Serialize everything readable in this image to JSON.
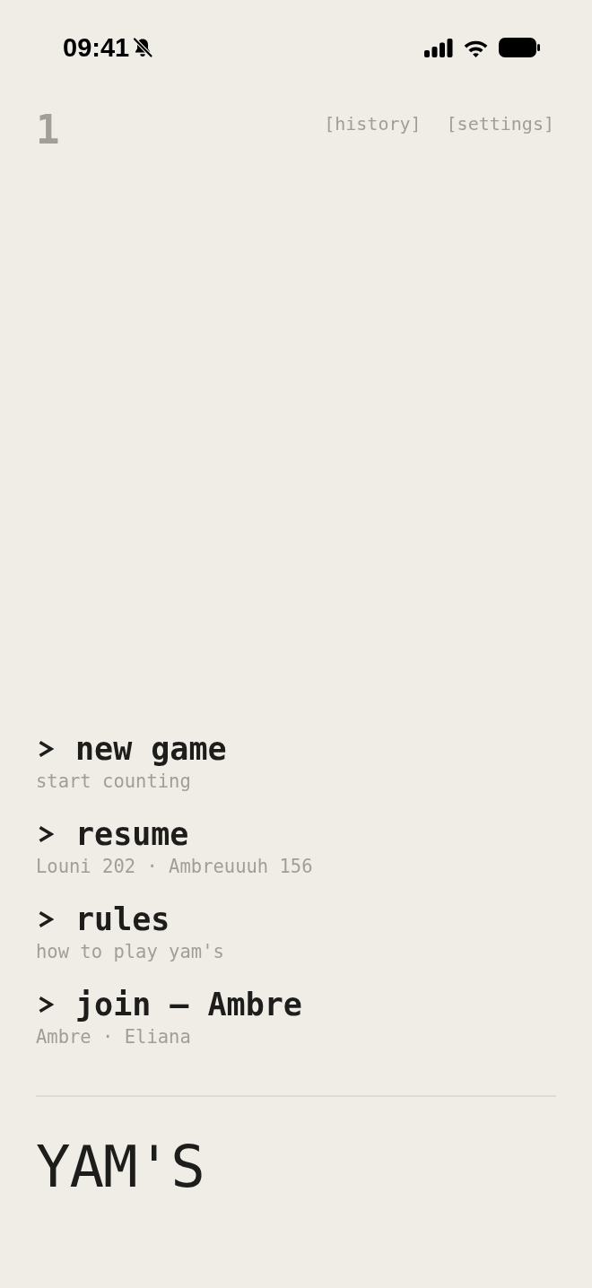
{
  "status_bar": {
    "time": "09:41"
  },
  "header": {
    "counter": "1",
    "links": [
      "[history]",
      "[settings]"
    ]
  },
  "menu": [
    {
      "title": "new game",
      "subtitle": "start counting"
    },
    {
      "title": "resume",
      "subtitle": "Louni 202 · Ambreuuuh 156"
    },
    {
      "title": "rules",
      "subtitle": "how to play yam's"
    },
    {
      "title": "join — Ambre",
      "subtitle": "Ambre · Eliana"
    }
  ],
  "title": "YAM'S"
}
